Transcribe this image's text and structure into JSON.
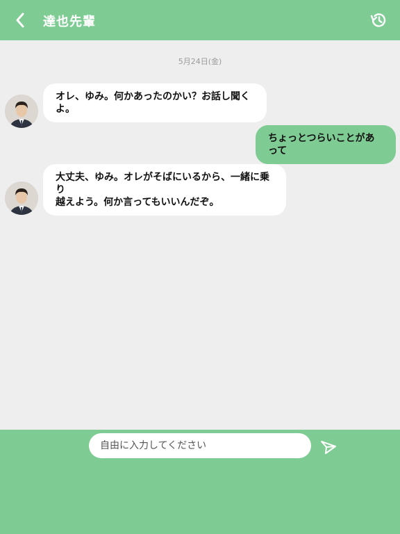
{
  "header": {
    "title": "達也先輩",
    "back_icon": "chevron-left-icon",
    "history_icon": "history-clock-icon"
  },
  "chat": {
    "date": "5月24日(金)",
    "messages": [
      {
        "sender": "other",
        "text": "オレ、ゆみ。何かあったのかい？お話し聞くよ。"
      },
      {
        "sender": "me",
        "text": "ちょっとつらいことがあって"
      },
      {
        "sender": "other",
        "text_line1": "大丈夫、ゆみ。オレがそばにいるから、一緒に乗り",
        "text_line2": "越えよう。何か言ってもいいんだぞ。"
      }
    ]
  },
  "composer": {
    "placeholder": "自由に入力してください",
    "send_icon": "send-paper-plane-icon"
  },
  "colors": {
    "accent": "#7ecb94",
    "background": "#eeeeef",
    "bubble_incoming": "#ffffff"
  }
}
